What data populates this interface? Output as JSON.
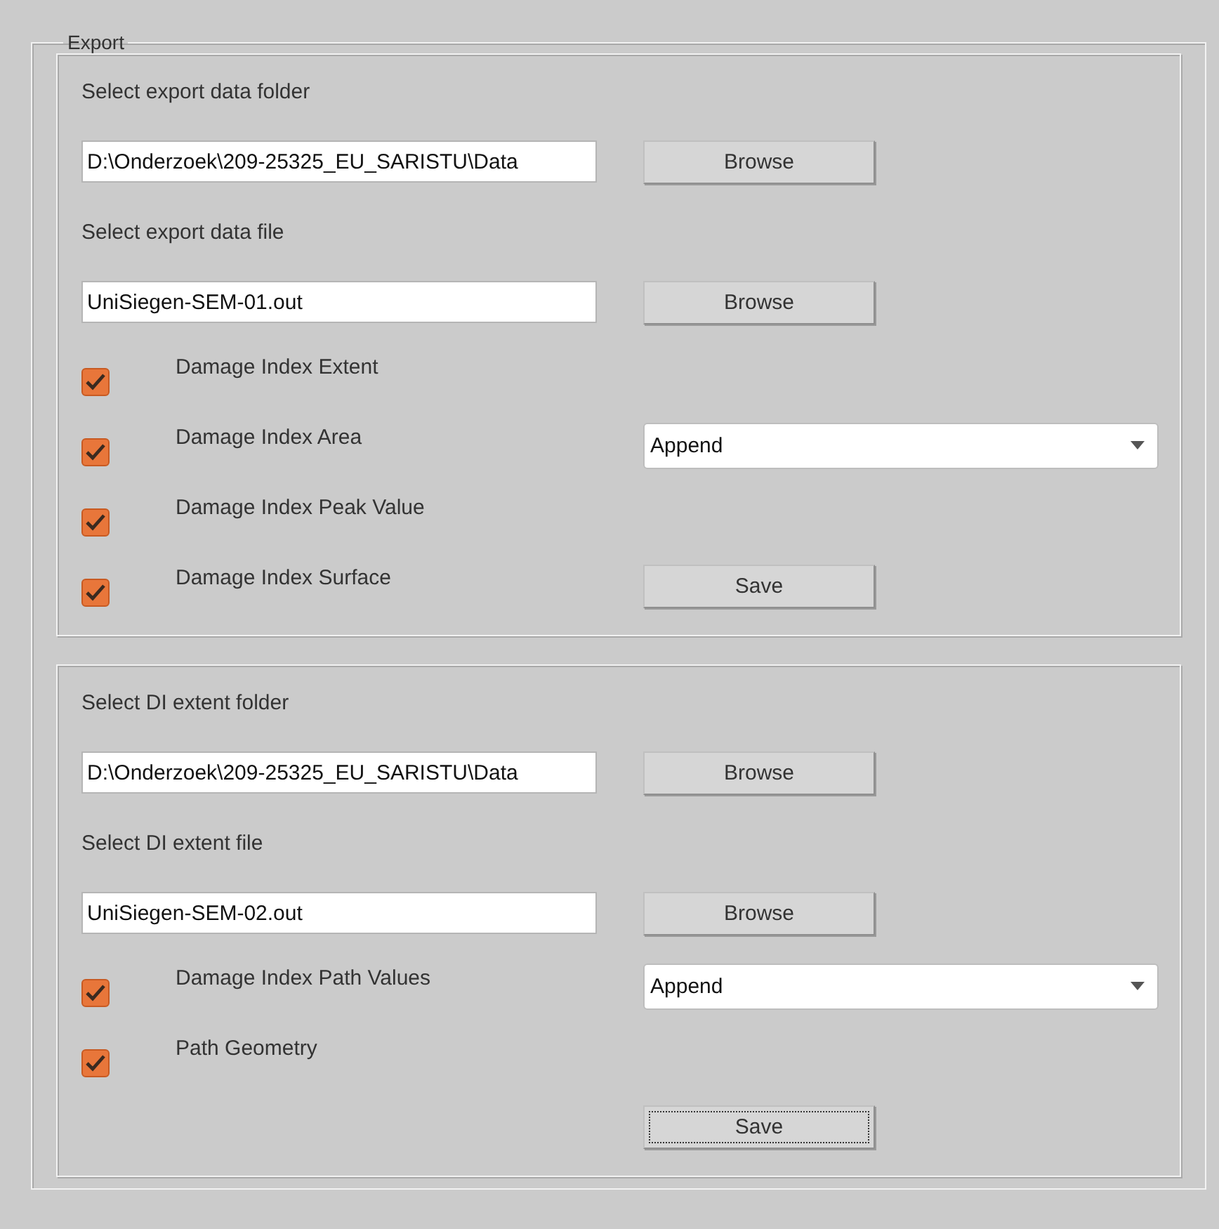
{
  "group": {
    "title": "Export"
  },
  "sections": [
    {
      "rows": [
        {
          "kind": "label",
          "text": "Select export data folder"
        },
        {
          "kind": "file",
          "value": "D:\\Onderzoek\\209-25325_EU_SARISTU\\Data",
          "button": "Browse"
        },
        {
          "kind": "label",
          "text": "Select export data file"
        },
        {
          "kind": "file",
          "value": "UniSiegen-SEM-01.out",
          "button": "Browse"
        },
        {
          "kind": "check",
          "label": "Damage Index Extent",
          "checked": true
        },
        {
          "kind": "check",
          "label": "Damage Index Area",
          "checked": true,
          "aside": {
            "kind": "select",
            "value": "Append"
          }
        },
        {
          "kind": "check",
          "label": "Damage Index Peak Value",
          "checked": true
        },
        {
          "kind": "check",
          "label": "Damage Index Surface",
          "checked": true,
          "aside": {
            "kind": "button",
            "label": "Save",
            "focused": false
          }
        }
      ]
    },
    {
      "rows": [
        {
          "kind": "label",
          "text": "Select DI extent folder"
        },
        {
          "kind": "file",
          "value": "D:\\Onderzoek\\209-25325_EU_SARISTU\\Data",
          "button": "Browse"
        },
        {
          "kind": "label",
          "text": "Select DI extent file"
        },
        {
          "kind": "file",
          "value": "UniSiegen-SEM-02.out",
          "button": "Browse"
        },
        {
          "kind": "check",
          "label": "Damage Index Path Values",
          "checked": true,
          "aside": {
            "kind": "select",
            "value": "Append"
          }
        },
        {
          "kind": "check",
          "label": "Path Geometry",
          "checked": true
        },
        {
          "kind": "button",
          "label": "Save",
          "focused": true
        }
      ]
    }
  ]
}
